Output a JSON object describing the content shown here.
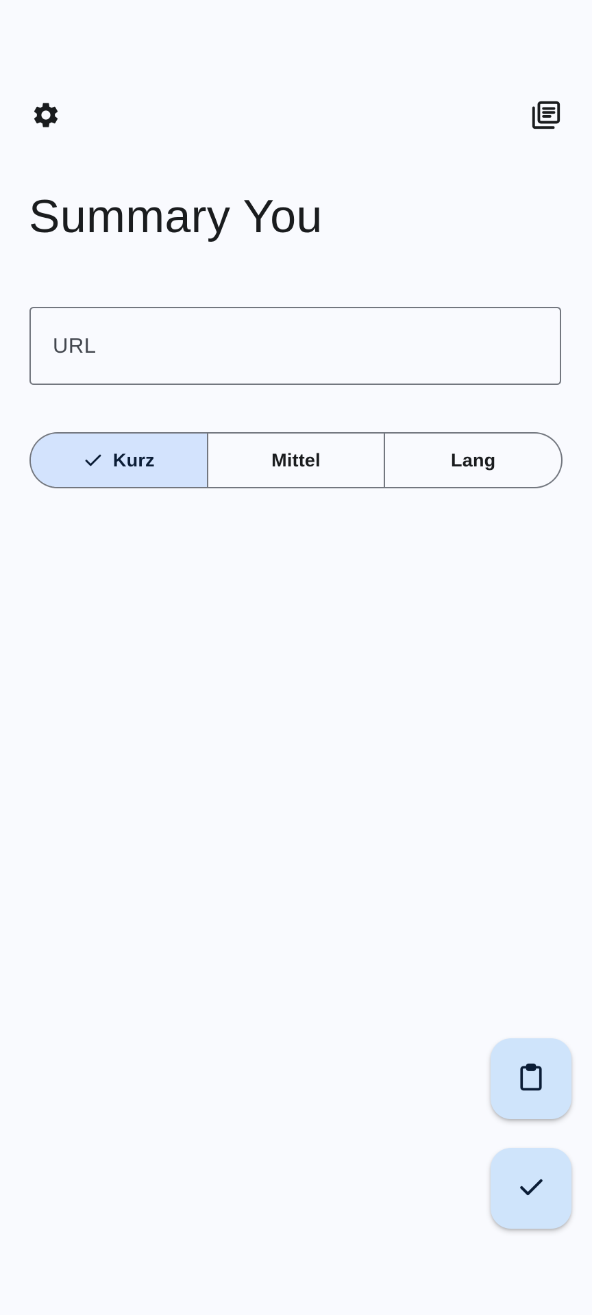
{
  "header": {
    "settings_icon": "gear-icon",
    "history_icon": "article-list-icon"
  },
  "page": {
    "title": "Summary You"
  },
  "url_field": {
    "placeholder": "URL",
    "value": ""
  },
  "length_selector": {
    "options": [
      {
        "label": "Kurz",
        "selected": true
      },
      {
        "label": "Mittel",
        "selected": false
      },
      {
        "label": "Lang",
        "selected": false
      }
    ]
  },
  "fabs": {
    "paste_icon": "clipboard-icon",
    "submit_icon": "check-icon"
  },
  "colors": {
    "background": "#f9fafe",
    "selected_segment": "#d3e3fd",
    "fab": "#cfe4fb",
    "outline": "#73777f",
    "text": "#1a1c1e"
  }
}
